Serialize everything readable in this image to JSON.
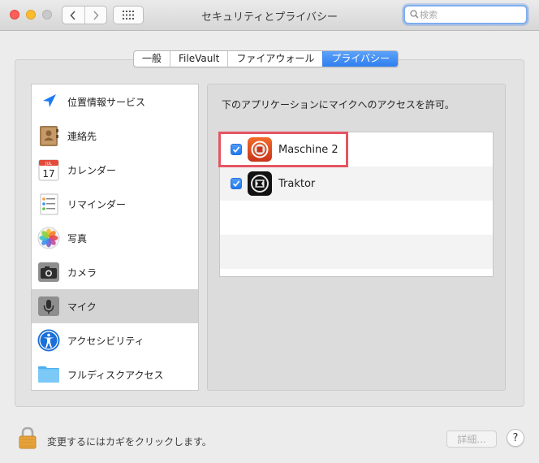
{
  "window": {
    "title": "セキュリティとプライバシー"
  },
  "search": {
    "placeholder": "検索",
    "value": ""
  },
  "tabs": [
    {
      "label": "一般"
    },
    {
      "label": "FileVault"
    },
    {
      "label": "ファイアウォール"
    },
    {
      "label": "プライバシー",
      "active": true
    }
  ],
  "sidebar": {
    "items": [
      {
        "label": "位置情報サービス",
        "icon": "location-arrow-icon"
      },
      {
        "label": "連絡先",
        "icon": "contacts-book-icon"
      },
      {
        "label": "カレンダー",
        "icon": "calendar-icon",
        "calendar_month": "JUL",
        "calendar_day": "17"
      },
      {
        "label": "リマインダー",
        "icon": "reminders-icon"
      },
      {
        "label": "写真",
        "icon": "photos-icon"
      },
      {
        "label": "カメラ",
        "icon": "camera-icon"
      },
      {
        "label": "マイク",
        "icon": "microphone-icon",
        "selected": true
      },
      {
        "label": "アクセシビリティ",
        "icon": "accessibility-icon"
      },
      {
        "label": "フルディスクアクセス",
        "icon": "folder-icon"
      }
    ]
  },
  "main": {
    "description": "下のアプリケーションにマイクへのアクセスを許可。",
    "apps": [
      {
        "name": "Maschine 2",
        "checked": true,
        "icon": "maschine-app-icon"
      },
      {
        "name": "Traktor",
        "checked": true,
        "icon": "traktor-app-icon"
      }
    ]
  },
  "footer": {
    "lock_text": "変更するにはカギをクリックします。",
    "details_label": "詳細...",
    "help_label": "?"
  },
  "colors": {
    "accent": "#2f7ff0",
    "highlight_box": "#e65562",
    "selected_row": "#d4d4d4"
  }
}
